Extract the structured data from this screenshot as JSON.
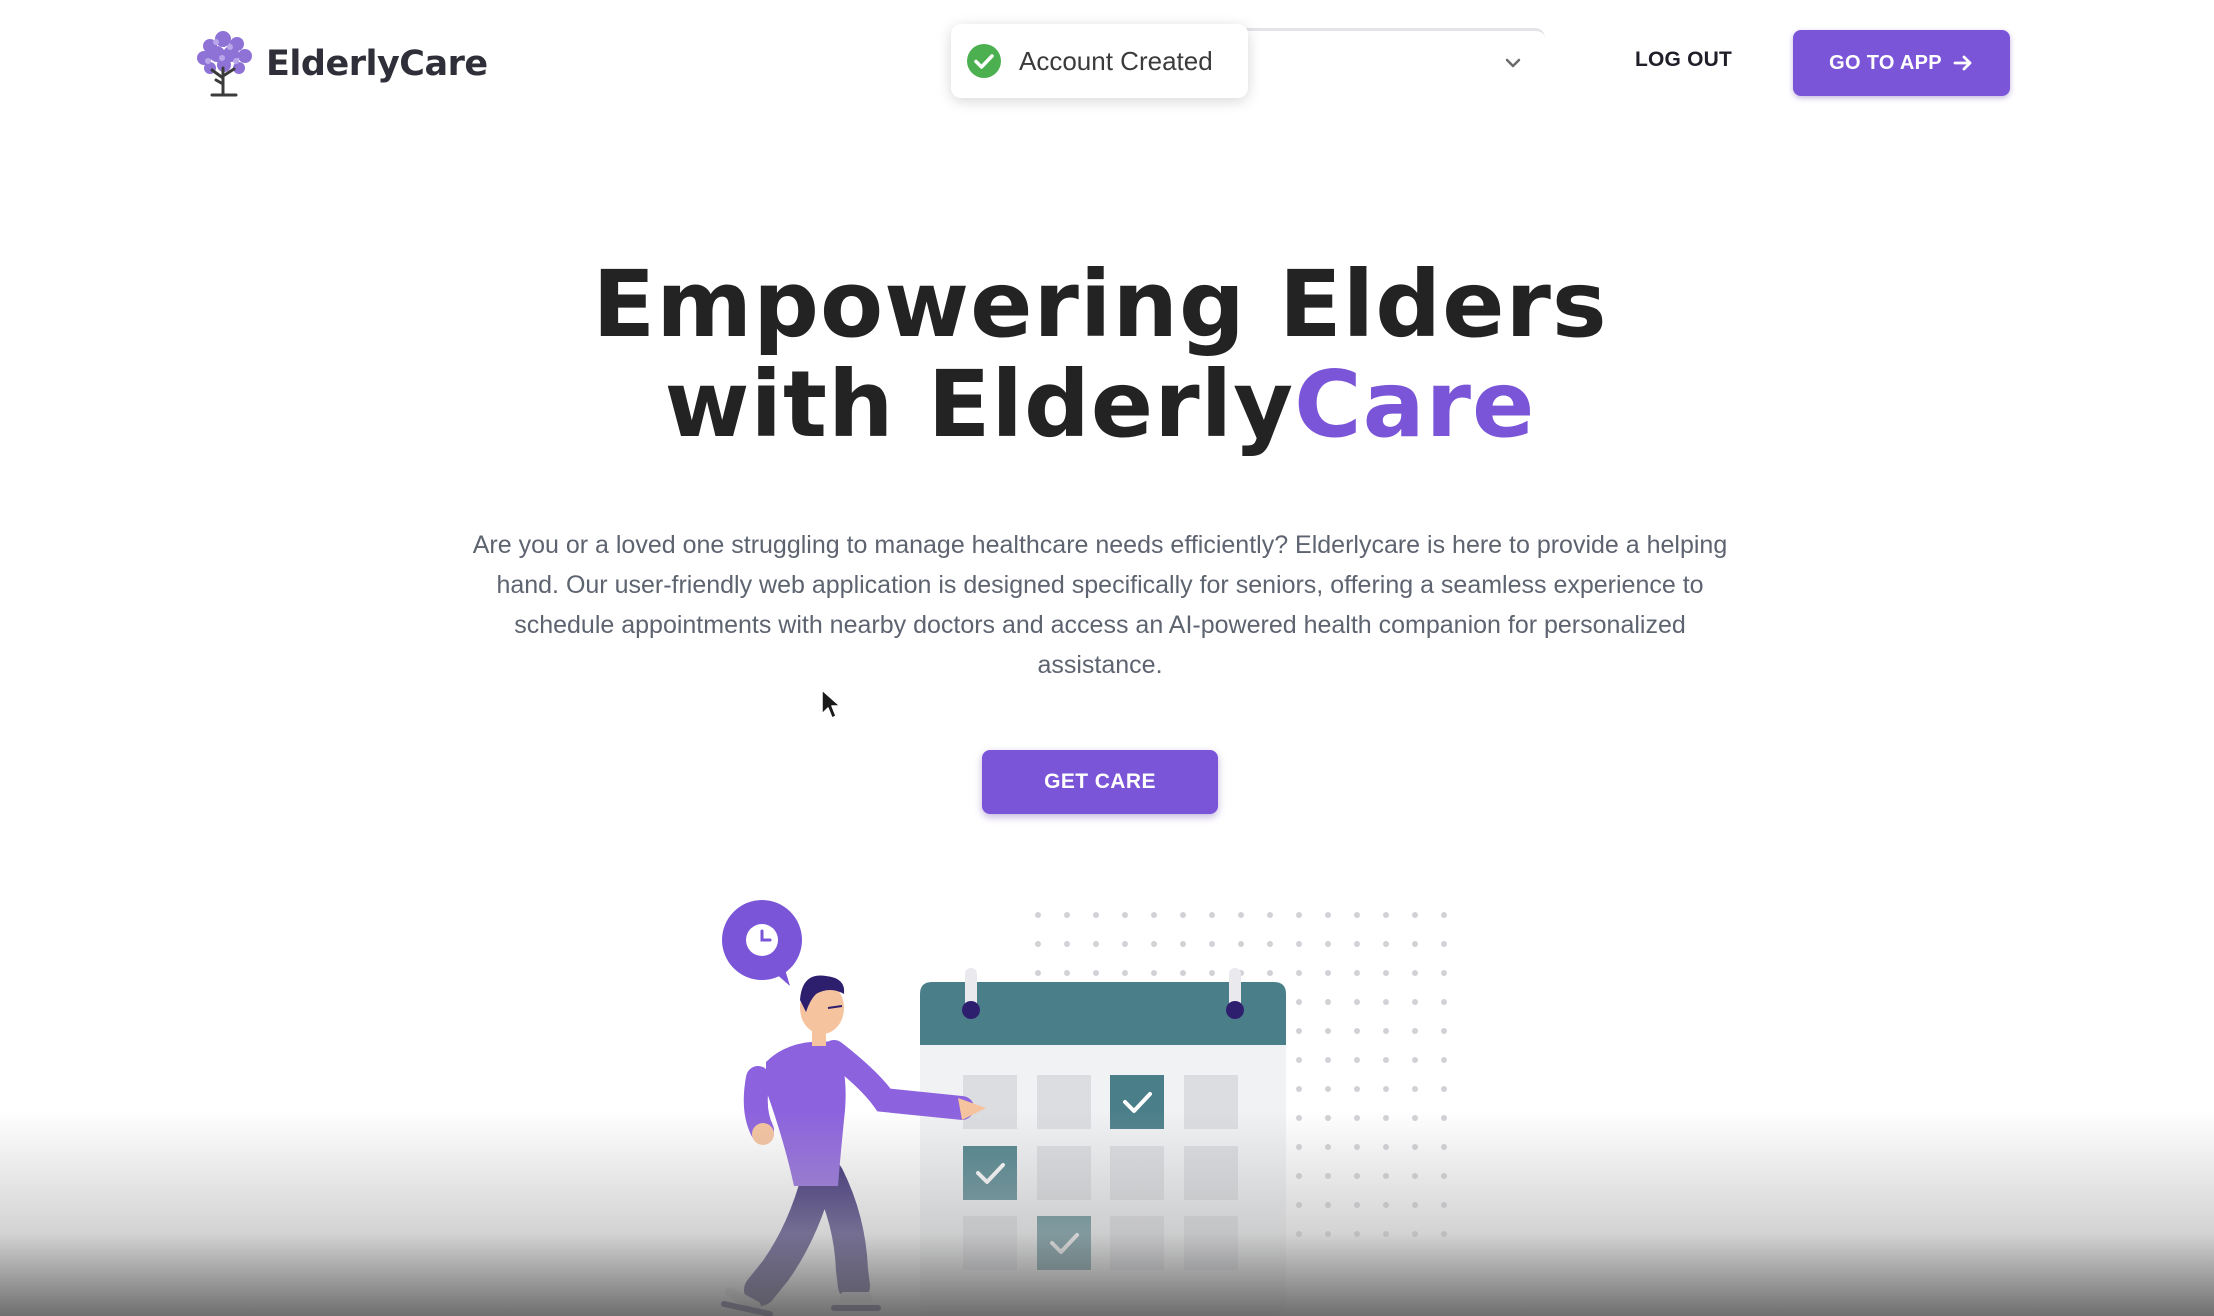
{
  "header": {
    "brand": "ElderlyCare",
    "logout_label": "LOG OUT",
    "goto_app_label": "GO TO APP"
  },
  "toast": {
    "message": "Account Created",
    "status_color": "#4caf50"
  },
  "hero": {
    "title_line1": "Empowering Elders",
    "title_line2_prefix": "with Elderly",
    "title_line2_accent": "Care",
    "description": "Are you or a loved one struggling to manage healthcare needs efficiently? Elderlycare is here to provide a helping hand. Our user-friendly web application is designed specifically for seniors, offering a seamless experience to schedule appointments with nearby doctors and access an AI-powered health companion for personalized assistance.",
    "cta_label": "GET CARE"
  },
  "colors": {
    "accent": "#7a55d8",
    "calendar_teal": "#4a7f89",
    "figure_dark": "#2d1f6e"
  },
  "icons": {
    "logo": "tree-logo-icon",
    "toast": "check-circle-icon",
    "select": "chevron-down-icon",
    "goto": "arrow-right-icon",
    "clock": "clock-icon"
  }
}
